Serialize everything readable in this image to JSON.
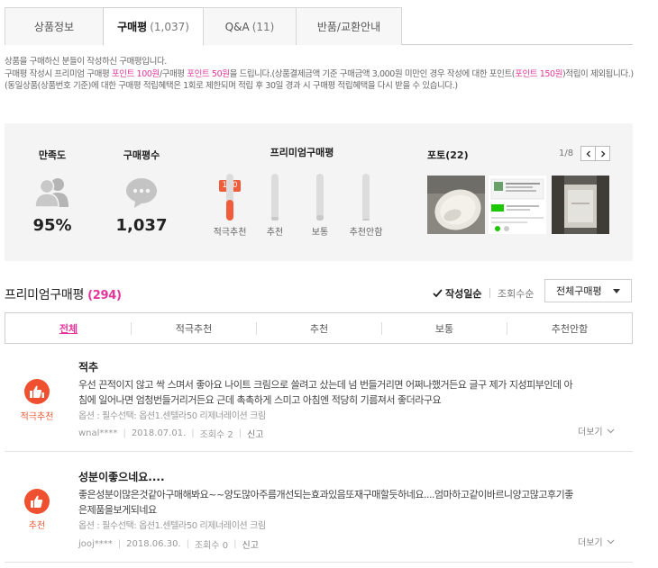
{
  "tabs": [
    {
      "label": "상품정보",
      "count": ""
    },
    {
      "label": "구매평",
      "count": "(1,037)"
    },
    {
      "label": "Q&A",
      "count": "(11)"
    },
    {
      "label": "반품/교환안내",
      "count": ""
    }
  ],
  "notice": {
    "line1": "상품을 구매하신 분들이 작성하신 구매평입니다.",
    "line2a": "구매평 작성시 프리미엄 구매평 ",
    "line2b": "포인트 100원",
    "line2c": "/구매평 ",
    "line2d": "포인트 50원",
    "line2e": "을 드립니다.(상품결제금액 기준 구매금액 3,000원 미만인 경우 작성에 대한 포인트(",
    "line2f": "포인트 150원",
    "line2g": ")적립이 제외됩니다.)",
    "line3": "(동일상품(상품번호 기준)에 대한 구매평 적립혜택은 1회로 제한되며 적립 후 30일 경과 시 구매평 적립혜택을 다시 받을 수 있습니다.)"
  },
  "summary": {
    "satisfaction_label": "만족도",
    "satisfaction_value": "95%",
    "review_count_label": "구매평수",
    "review_count_value": "1,037",
    "premium_label": "프리미엄구매평",
    "bars": [
      {
        "label": "적극추천",
        "value": 170,
        "fill": 0.45,
        "active": true
      },
      {
        "label": "추천",
        "value": 0,
        "fill": 0.08,
        "active": false
      },
      {
        "label": "보통",
        "value": 0,
        "fill": 0.12,
        "active": false
      },
      {
        "label": "추천안함",
        "value": 0,
        "fill": 0.04,
        "active": false
      }
    ],
    "bar_badge": "170",
    "photo_label": "포토(22)",
    "photo_pager": "1/8"
  },
  "premium": {
    "title": "프리미엄구매평",
    "count": "(294)",
    "sort_recent": "작성일순",
    "sort_views": "조회수순",
    "select_value": "전체구매평"
  },
  "filters": [
    "전체",
    "적극추천",
    "추천",
    "보통",
    "추천안함"
  ],
  "reviews": [
    {
      "badge": "적극추천",
      "title": "적추",
      "body1": "우선 끈적이지 않고 싹 스며서 좋아요 나이트 크림으로 쓸려고 샀는데 넘 번들거리면 어쩌나했거든요 글구 제가 지성피부인데 아",
      "body2": "침에 일어나면 엄청번들거리거든요 근데 촉촉하게 스미고 아침엔 적당히 기름져서 좋더라구요",
      "option": "옵션 : 필수선택: 옵션1.센텔라50 리제너레이션 크림",
      "user": "wnal****",
      "date": "2018.07.01.",
      "views": "조회수 2",
      "report": "신고",
      "more": "더보기"
    },
    {
      "badge": "추천",
      "title": "성분이좋으네요....",
      "body1": "좋은성분이많은것같아구매해봐요~~양도많아주름개선되는효과있음또재구매할듯하네요....엄마하고같이바르니양고많고후기좋",
      "body2": "은제품을보게되네요",
      "option": "옵션 : 필수선택: 옵션1.센텔라50 리제너레이션 크림",
      "user": "jooj****",
      "date": "2018.06.30.",
      "views": "조회수 0",
      "report": "신고",
      "more": "더보기"
    }
  ],
  "colors": {
    "accent_pink": "#e5359b",
    "badge_red": "#ef5030"
  }
}
